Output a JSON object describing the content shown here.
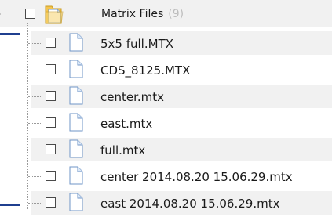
{
  "tree": {
    "parent": {
      "label": "Matrix Files",
      "count": "(9)",
      "icon": "folder-document-icon"
    },
    "children": [
      {
        "label": "5x5 full.MTX",
        "icon": "document-icon"
      },
      {
        "label": "CDS_8125.MTX",
        "icon": "document-icon"
      },
      {
        "label": "center.mtx",
        "icon": "document-icon"
      },
      {
        "label": "east.mtx",
        "icon": "document-icon"
      },
      {
        "label": "full.mtx",
        "icon": "document-icon"
      },
      {
        "label": "center 2014.08.20 15.06.29.mtx",
        "icon": "document-icon"
      },
      {
        "label": "east 2014.08.20 15.06.29.mtx",
        "icon": "document-icon"
      }
    ]
  },
  "colors": {
    "row_shade": "#f1f1f1",
    "count_text": "#bdbdbd",
    "accent_mark": "#1f3f8f"
  }
}
